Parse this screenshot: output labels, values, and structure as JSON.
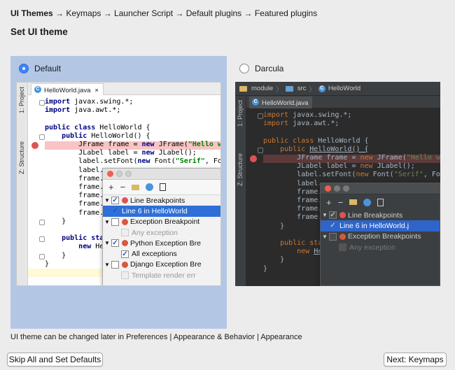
{
  "breadcrumb": {
    "current": "UI Themes",
    "rest": "→ Keymaps → Launcher Script → Default plugins → Featured plugins"
  },
  "page_title": "Set UI theme",
  "themes": {
    "default": {
      "label": "Default",
      "selected": true,
      "sidebar_project": "1: Project",
      "sidebar_structure": "Z: Structure",
      "tab": "HelloWorld.java",
      "tab_close": "×"
    },
    "darcula": {
      "label": "Darcula",
      "selected": false,
      "nav_module": "module",
      "nav_src": "src",
      "nav_class": "HelloWorld",
      "sidebar_project": "1: Project",
      "sidebar_structure": "Z: Structure",
      "tab": "HelloWorld.java"
    }
  },
  "code": {
    "import1": "javax.swing.*;",
    "import2": "java.awt.*;",
    "kw_import": "import",
    "kw_public": "public",
    "kw_class": "class",
    "kw_new": "new",
    "class_decl": "HelloWorld {",
    "ctor": "HelloWorld() {",
    "line_frame_a": "JFrame frame = ",
    "line_frame_b": "JFrame(",
    "str_hello": "\"Hello wor",
    "str_hello_dark": "\"Hello world",
    "line_label_a": "JLabel label = ",
    "line_label_b": "JLabel();",
    "line_font_a": "label.setFont(",
    "line_font_b": "Font(",
    "str_serif": "\"Serif\"",
    "line_font_tail": ", Font",
    "label_short": "label.",
    "frame_short": "frame.",
    "close": "}",
    "public_sta": "sta",
    "new_he": "He"
  },
  "popup": {
    "toolbar": [
      "+",
      "−"
    ],
    "items": [
      {
        "label": "Line Breakpoints",
        "checked": true
      },
      {
        "label": "Line 6 in HelloWorld",
        "checked": true
      },
      {
        "label": "Exception Breakpoint",
        "checked": false
      },
      {
        "label": "Any exception",
        "checked": false
      },
      {
        "label": "Python Exception Bre",
        "checked": true
      },
      {
        "label": "All exceptions",
        "checked": true
      },
      {
        "label": "Django Exception Bre",
        "checked": false
      },
      {
        "label": "Template render err",
        "checked": false
      }
    ],
    "dark_items": [
      {
        "label": "Line Breakpoints",
        "checked": true
      },
      {
        "label": "Line 6 in HelloWorld.j",
        "checked": true
      },
      {
        "label": "Exception Breakpoints",
        "checked": false
      },
      {
        "label": "Any exception",
        "checked": false
      }
    ]
  },
  "hint": "UI theme can be changed later in Preferences | Appearance & Behavior | Appearance",
  "buttons": {
    "skip": "Skip All and Set Defaults",
    "next": "Next: Keymaps"
  }
}
